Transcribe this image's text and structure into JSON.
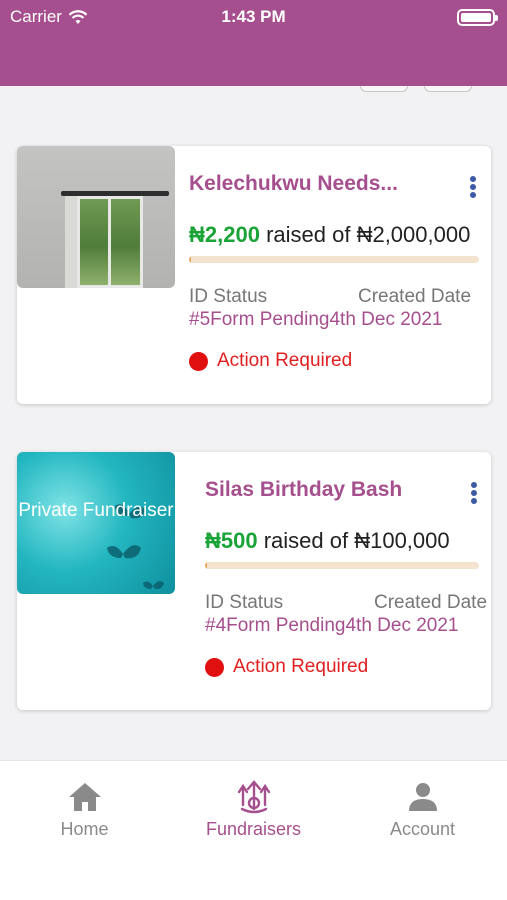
{
  "status_bar": {
    "carrier": "Carrier",
    "time": "1:43 PM"
  },
  "fundraisers": [
    {
      "title": "Kelechukwu Needs...",
      "amount_raised": "₦2,200",
      "raised_of_text": "raised of ₦2,000,000",
      "progress_fraction": 0.0011,
      "thumbnail_text": "",
      "id_label": "ID",
      "status_label": "Status",
      "created_label": "Created Date",
      "id_status_date_value": "#5Form Pending4th Dec 2021",
      "action": "Action Required"
    },
    {
      "title": "Silas Birthday Bash",
      "amount_raised": "₦500",
      "raised_of_text": "raised of ₦100,000",
      "progress_fraction": 0.005,
      "thumbnail_text": "Private Fundraiser",
      "id_label": "ID",
      "status_label": "Status",
      "created_label": "Created Date",
      "id_status_date_value": "#4Form Pending4th Dec 2021",
      "action": "Action Required"
    }
  ],
  "tabs": [
    {
      "label": "Home",
      "icon": "home-icon",
      "active": false
    },
    {
      "label": "Fundraisers",
      "icon": "fundraisers-icon",
      "active": true
    },
    {
      "label": "Account",
      "icon": "account-icon",
      "active": false
    }
  ],
  "colors": {
    "brand": "#a64f8e",
    "amount": "#1aa336",
    "alert": "#e01010",
    "progress": "#e0a65c",
    "menu_dots": "#3b5aa6"
  }
}
